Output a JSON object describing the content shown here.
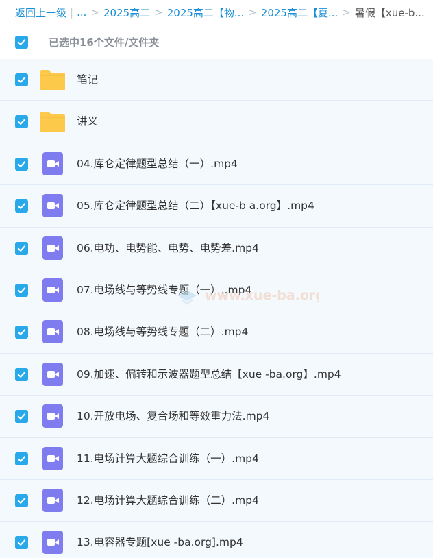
{
  "breadcrumb": {
    "back": "返回上一级",
    "ellipsis": "...",
    "crumbs": [
      "2025高二",
      "2025高二【物...",
      "2025高二【夏..."
    ],
    "current": "暑假【xue-b..."
  },
  "selection": {
    "label": "已选中16个文件/文件夹",
    "checked": true
  },
  "files": [
    {
      "name": "笔记",
      "type": "folder",
      "checked": true
    },
    {
      "name": "讲义",
      "type": "folder",
      "checked": true
    },
    {
      "name": "04.库仑定律题型总结（一）.mp4",
      "type": "video",
      "checked": true
    },
    {
      "name": "05.库仑定律题型总结（二）【xue-b a.org】.mp4",
      "type": "video",
      "checked": true
    },
    {
      "name": "06.电功、电势能、电势、电势差.mp4",
      "type": "video",
      "checked": true
    },
    {
      "name": "07.电场线与等势线专题（一）..mp4",
      "type": "video",
      "checked": true
    },
    {
      "name": "08.电场线与等势线专题（二）.mp4",
      "type": "video",
      "checked": true
    },
    {
      "name": "09.加速、偏转和示波器题型总结【xue -ba.org】.mp4",
      "type": "video",
      "checked": true
    },
    {
      "name": "10.开放电场、复合场和等效重力法.mp4",
      "type": "video",
      "checked": true
    },
    {
      "name": "11.电场计算大题综合训练（一）.mp4",
      "type": "video",
      "checked": true
    },
    {
      "name": "12.电场计算大题综合训练（二）.mp4",
      "type": "video",
      "checked": true
    },
    {
      "name": "13.电容器专题[xue -ba.org].mp4",
      "type": "video",
      "checked": true
    }
  ],
  "watermark": "www.xue-ba.org",
  "colors": {
    "link": "#1a8fd6",
    "checkbox": "#29a9ea",
    "folder": "#fcc94a",
    "video": "#7f7cf0",
    "row_bg": "#f4f9fd"
  },
  "icons": {
    "checkbox": "check-icon",
    "folder": "folder-icon",
    "video": "video-file-icon"
  }
}
